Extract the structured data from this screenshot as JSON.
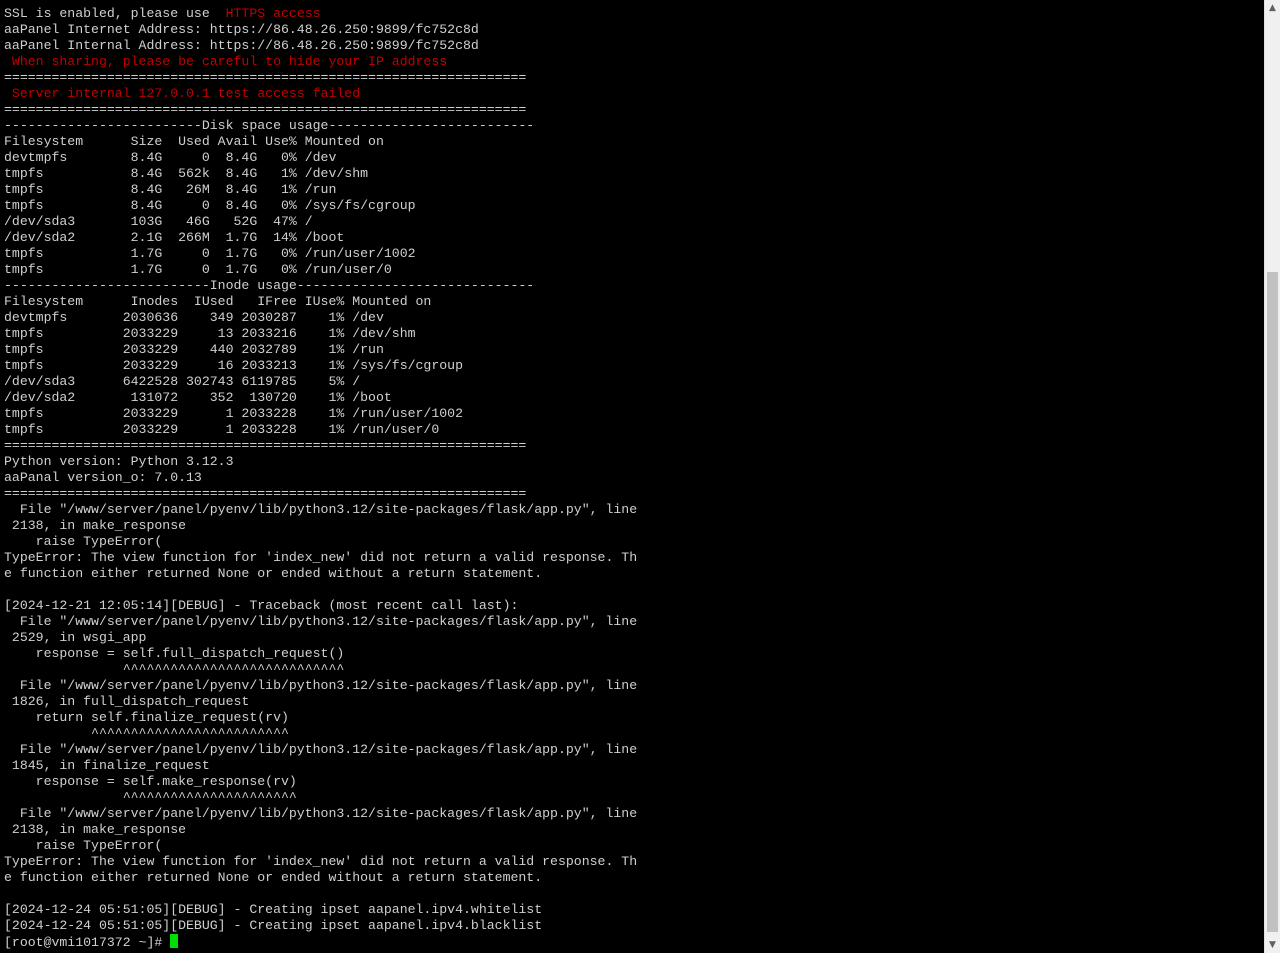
{
  "terminal": {
    "lines": [
      {
        "text": "SSL is enabled, please use  ",
        "red": "HTTPS access"
      },
      {
        "text": "aaPanel Internet Address: https://86.48.26.250:9899/fc752c8d"
      },
      {
        "text": "aaPanel Internal Address: https://86.48.26.250:9899/fc752c8d"
      },
      {
        "text": "",
        "red": " When sharing, please be careful to hide your IP address"
      },
      {
        "text": "==================================================================",
        "color": "red"
      },
      {
        "text": "",
        "red": " Server internal 127.0.0.1 test access failed"
      },
      {
        "text": "=================================================================="
      },
      {
        "text": "-------------------------Disk space usage--------------------------"
      },
      {
        "text": "Filesystem      Size  Used Avail Use% Mounted on"
      },
      {
        "text": "devtmpfs        8.4G     0  8.4G   0% /dev"
      },
      {
        "text": "tmpfs           8.4G  562k  8.4G   1% /dev/shm"
      },
      {
        "text": "tmpfs           8.4G   26M  8.4G   1% /run"
      },
      {
        "text": "tmpfs           8.4G     0  8.4G   0% /sys/fs/cgroup"
      },
      {
        "text": "/dev/sda3       103G   46G   52G  47% /"
      },
      {
        "text": "/dev/sda2       2.1G  266M  1.7G  14% /boot"
      },
      {
        "text": "tmpfs           1.7G     0  1.7G   0% /run/user/1002"
      },
      {
        "text": "tmpfs           1.7G     0  1.7G   0% /run/user/0"
      },
      {
        "text": "--------------------------Inode usage------------------------------"
      },
      {
        "text": "Filesystem      Inodes  IUsed   IFree IUse% Mounted on"
      },
      {
        "text": "devtmpfs       2030636    349 2030287    1% /dev"
      },
      {
        "text": "tmpfs          2033229     13 2033216    1% /dev/shm"
      },
      {
        "text": "tmpfs          2033229    440 2032789    1% /run"
      },
      {
        "text": "tmpfs          2033229     16 2033213    1% /sys/fs/cgroup"
      },
      {
        "text": "/dev/sda3      6422528 302743 6119785    5% /"
      },
      {
        "text": "/dev/sda2       131072    352  130720    1% /boot"
      },
      {
        "text": "tmpfs          2033229      1 2033228    1% /run/user/1002"
      },
      {
        "text": "tmpfs          2033229      1 2033228    1% /run/user/0"
      },
      {
        "text": "=================================================================="
      },
      {
        "text": "Python version: Python 3.12.3"
      },
      {
        "text": "aaPanal version_o: 7.0.13"
      },
      {
        "text": "=================================================================="
      },
      {
        "text": "  File \"/www/server/panel/pyenv/lib/python3.12/site-packages/flask/app.py\", line"
      },
      {
        "text": " 2138, in make_response"
      },
      {
        "text": "    raise TypeError("
      },
      {
        "text": "TypeError: The view function for 'index_new' did not return a valid response. Th"
      },
      {
        "text": "e function either returned None or ended without a return statement."
      },
      {
        "text": ""
      },
      {
        "text": "[2024-12-21 12:05:14][DEBUG] - Traceback (most recent call last):"
      },
      {
        "text": "  File \"/www/server/panel/pyenv/lib/python3.12/site-packages/flask/app.py\", line"
      },
      {
        "text": " 2529, in wsgi_app"
      },
      {
        "text": "    response = self.full_dispatch_request()"
      },
      {
        "text": "               ^^^^^^^^^^^^^^^^^^^^^^^^^^^^"
      },
      {
        "text": "  File \"/www/server/panel/pyenv/lib/python3.12/site-packages/flask/app.py\", line"
      },
      {
        "text": " 1826, in full_dispatch_request"
      },
      {
        "text": "    return self.finalize_request(rv)"
      },
      {
        "text": "           ^^^^^^^^^^^^^^^^^^^^^^^^^"
      },
      {
        "text": "  File \"/www/server/panel/pyenv/lib/python3.12/site-packages/flask/app.py\", line"
      },
      {
        "text": " 1845, in finalize_request"
      },
      {
        "text": "    response = self.make_response(rv)"
      },
      {
        "text": "               ^^^^^^^^^^^^^^^^^^^^^^"
      },
      {
        "text": "  File \"/www/server/panel/pyenv/lib/python3.12/site-packages/flask/app.py\", line"
      },
      {
        "text": " 2138, in make_response"
      },
      {
        "text": "    raise TypeError("
      },
      {
        "text": "TypeError: The view function for 'index_new' did not return a valid response. Th"
      },
      {
        "text": "e function either returned None or ended without a return statement."
      },
      {
        "text": ""
      },
      {
        "text": "[2024-12-24 05:51:05][DEBUG] - Creating ipset aapanel.ipv4.whitelist"
      },
      {
        "text": "[2024-12-24 05:51:05][DEBUG] - Creating ipset aapanel.ipv4.blacklist"
      }
    ],
    "prompt": "[root@vmi1017372 ~]# ",
    "colors": {
      "background": "#000000",
      "foreground": "#d0d0d0",
      "warning": "#c00000",
      "cursor": "#00e000"
    }
  },
  "scrollbar": {
    "up_icon": "▲",
    "down_icon": "▼"
  }
}
